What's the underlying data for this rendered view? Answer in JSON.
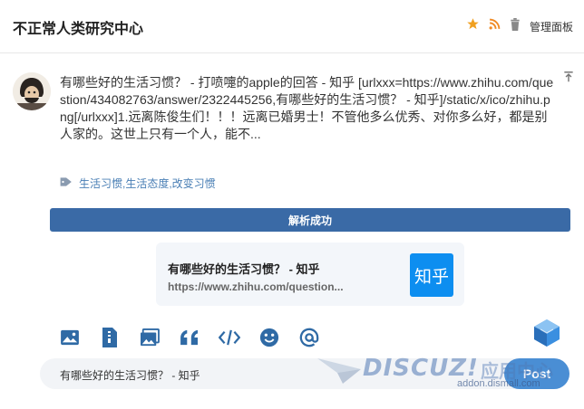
{
  "header": {
    "title": "不正常人类研究中心",
    "admin_label": "管理面板",
    "icons": [
      "star-icon",
      "rss-icon",
      "trash-icon"
    ],
    "star_color": "#f0a020",
    "rss_color": "#f08a24"
  },
  "post": {
    "content": "有哪些好的生活习惯？ - 打喷嚏的apple的回答 - 知乎 [urlxxx=https://www.zhihu.com/question/434082763/answer/2322445256,有哪些好的生活习惯？ - 知乎]/static/x/ico/zhihu.png[/urlxxx]1.远离陈俊生们！！！远离已婚男士！不管他多么优秀、对你多么好，都是别人家的。这世上只有一个人，能不...",
    "tags": "生活习惯,生活态度,改变习惯"
  },
  "parse_status": "解析成功",
  "link_card": {
    "title": "有哪些好的生活习惯？ - 知乎",
    "url": "https://www.zhihu.com/question...",
    "logo_text": "知乎"
  },
  "toolbar": {
    "tools": [
      "image-icon",
      "file-icon",
      "gallery-icon",
      "quote-icon",
      "code-icon",
      "emoji-icon",
      "mention-icon"
    ]
  },
  "reply": {
    "value": "有哪些好的生活习惯？ - 知乎",
    "post_label": "Post"
  },
  "watermark": {
    "brand": "DISCUZ!",
    "cn": "应用中心",
    "url": "addon.dismall.com"
  },
  "colors": {
    "accent": "#3a6aa6",
    "link": "#4a7fb5",
    "zhihu_blue": "#0d8ef0"
  }
}
